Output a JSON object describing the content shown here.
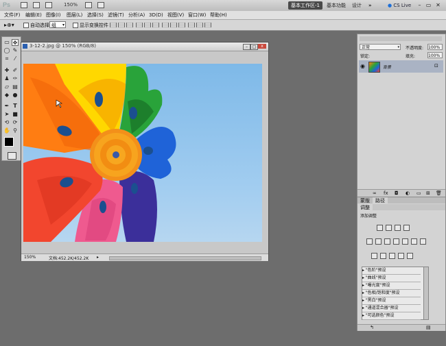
{
  "app": {
    "logo": "Ps",
    "zoom": "150%",
    "workspace_active": "基本工作区-1",
    "workspace_basic": "基本功能",
    "workspace_design": "设计",
    "more": "»",
    "cs_live": "CS Live"
  },
  "menu": [
    "文件(F)",
    "编辑(E)",
    "图像(I)",
    "图层(L)",
    "选择(S)",
    "滤镜(T)",
    "分析(A)",
    "3D(D)",
    "视图(V)",
    "窗口(W)",
    "帮助(H)"
  ],
  "options": {
    "auto_select": "自动选择:",
    "auto_select_value": "组",
    "show_transform": "显示变换控件"
  },
  "document": {
    "title": "3-12-2.jpg @ 150% (RGB/8)",
    "zoom": "150%",
    "doc_info": "文档:452.2K/452.2K"
  },
  "layers_panel": {
    "blend_mode": "正常",
    "opacity_label": "不透明度:",
    "opacity": "100%",
    "lock_label": "锁定:",
    "fill_label": "填充:",
    "fill": "100%",
    "layer_name": "背景"
  },
  "lower_panel": {
    "tabs": [
      "蒙版",
      "路径"
    ],
    "adjust_tab": "调整",
    "add_adjustment": "添加调整",
    "presets": [
      "\"色阶\"预设",
      "\"曲线\"预设",
      "\"曝光度\"预设",
      "\"色相/饱和度\"预设",
      "\"黑白\"预设",
      "\"通道混合器\"预设",
      "\"可选颜色\"预设"
    ]
  },
  "colors": {
    "workspace_bg": "#6d6d6d",
    "sky": "#8cc2ee",
    "accent_active_ws": "#4a4a4a"
  }
}
